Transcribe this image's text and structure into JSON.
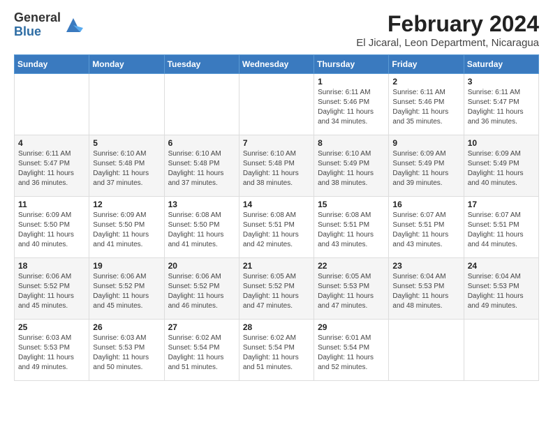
{
  "logo": {
    "general": "General",
    "blue": "Blue"
  },
  "title": {
    "month_year": "February 2024",
    "location": "El Jicaral, Leon Department, Nicaragua"
  },
  "headers": [
    "Sunday",
    "Monday",
    "Tuesday",
    "Wednesday",
    "Thursday",
    "Friday",
    "Saturday"
  ],
  "weeks": [
    [
      {
        "day": "",
        "info": ""
      },
      {
        "day": "",
        "info": ""
      },
      {
        "day": "",
        "info": ""
      },
      {
        "day": "",
        "info": ""
      },
      {
        "day": "1",
        "info": "Sunrise: 6:11 AM\nSunset: 5:46 PM\nDaylight: 11 hours\nand 34 minutes."
      },
      {
        "day": "2",
        "info": "Sunrise: 6:11 AM\nSunset: 5:46 PM\nDaylight: 11 hours\nand 35 minutes."
      },
      {
        "day": "3",
        "info": "Sunrise: 6:11 AM\nSunset: 5:47 PM\nDaylight: 11 hours\nand 36 minutes."
      }
    ],
    [
      {
        "day": "4",
        "info": "Sunrise: 6:11 AM\nSunset: 5:47 PM\nDaylight: 11 hours\nand 36 minutes."
      },
      {
        "day": "5",
        "info": "Sunrise: 6:10 AM\nSunset: 5:48 PM\nDaylight: 11 hours\nand 37 minutes."
      },
      {
        "day": "6",
        "info": "Sunrise: 6:10 AM\nSunset: 5:48 PM\nDaylight: 11 hours\nand 37 minutes."
      },
      {
        "day": "7",
        "info": "Sunrise: 6:10 AM\nSunset: 5:48 PM\nDaylight: 11 hours\nand 38 minutes."
      },
      {
        "day": "8",
        "info": "Sunrise: 6:10 AM\nSunset: 5:49 PM\nDaylight: 11 hours\nand 38 minutes."
      },
      {
        "day": "9",
        "info": "Sunrise: 6:09 AM\nSunset: 5:49 PM\nDaylight: 11 hours\nand 39 minutes."
      },
      {
        "day": "10",
        "info": "Sunrise: 6:09 AM\nSunset: 5:49 PM\nDaylight: 11 hours\nand 40 minutes."
      }
    ],
    [
      {
        "day": "11",
        "info": "Sunrise: 6:09 AM\nSunset: 5:50 PM\nDaylight: 11 hours\nand 40 minutes."
      },
      {
        "day": "12",
        "info": "Sunrise: 6:09 AM\nSunset: 5:50 PM\nDaylight: 11 hours\nand 41 minutes."
      },
      {
        "day": "13",
        "info": "Sunrise: 6:08 AM\nSunset: 5:50 PM\nDaylight: 11 hours\nand 41 minutes."
      },
      {
        "day": "14",
        "info": "Sunrise: 6:08 AM\nSunset: 5:51 PM\nDaylight: 11 hours\nand 42 minutes."
      },
      {
        "day": "15",
        "info": "Sunrise: 6:08 AM\nSunset: 5:51 PM\nDaylight: 11 hours\nand 43 minutes."
      },
      {
        "day": "16",
        "info": "Sunrise: 6:07 AM\nSunset: 5:51 PM\nDaylight: 11 hours\nand 43 minutes."
      },
      {
        "day": "17",
        "info": "Sunrise: 6:07 AM\nSunset: 5:51 PM\nDaylight: 11 hours\nand 44 minutes."
      }
    ],
    [
      {
        "day": "18",
        "info": "Sunrise: 6:06 AM\nSunset: 5:52 PM\nDaylight: 11 hours\nand 45 minutes."
      },
      {
        "day": "19",
        "info": "Sunrise: 6:06 AM\nSunset: 5:52 PM\nDaylight: 11 hours\nand 45 minutes."
      },
      {
        "day": "20",
        "info": "Sunrise: 6:06 AM\nSunset: 5:52 PM\nDaylight: 11 hours\nand 46 minutes."
      },
      {
        "day": "21",
        "info": "Sunrise: 6:05 AM\nSunset: 5:52 PM\nDaylight: 11 hours\nand 47 minutes."
      },
      {
        "day": "22",
        "info": "Sunrise: 6:05 AM\nSunset: 5:53 PM\nDaylight: 11 hours\nand 47 minutes."
      },
      {
        "day": "23",
        "info": "Sunrise: 6:04 AM\nSunset: 5:53 PM\nDaylight: 11 hours\nand 48 minutes."
      },
      {
        "day": "24",
        "info": "Sunrise: 6:04 AM\nSunset: 5:53 PM\nDaylight: 11 hours\nand 49 minutes."
      }
    ],
    [
      {
        "day": "25",
        "info": "Sunrise: 6:03 AM\nSunset: 5:53 PM\nDaylight: 11 hours\nand 49 minutes."
      },
      {
        "day": "26",
        "info": "Sunrise: 6:03 AM\nSunset: 5:53 PM\nDaylight: 11 hours\nand 50 minutes."
      },
      {
        "day": "27",
        "info": "Sunrise: 6:02 AM\nSunset: 5:54 PM\nDaylight: 11 hours\nand 51 minutes."
      },
      {
        "day": "28",
        "info": "Sunrise: 6:02 AM\nSunset: 5:54 PM\nDaylight: 11 hours\nand 51 minutes."
      },
      {
        "day": "29",
        "info": "Sunrise: 6:01 AM\nSunset: 5:54 PM\nDaylight: 11 hours\nand 52 minutes."
      },
      {
        "day": "",
        "info": ""
      },
      {
        "day": "",
        "info": ""
      }
    ]
  ]
}
